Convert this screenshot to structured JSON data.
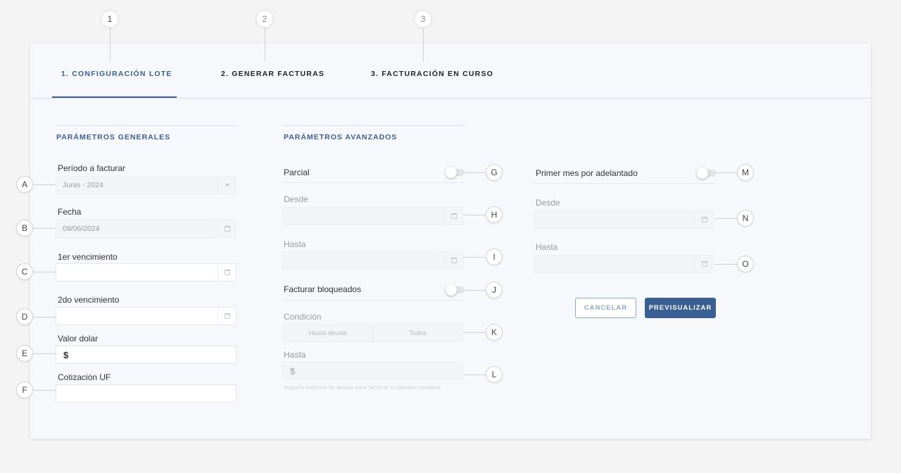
{
  "markers": {
    "step1": "1",
    "step2": "2",
    "step3": "3",
    "a": "A",
    "b": "B",
    "c": "C",
    "d": "D",
    "e": "E",
    "f": "F",
    "g": "G",
    "h": "H",
    "i": "I",
    "j": "J",
    "k": "K",
    "l": "L",
    "m": "M",
    "n": "N",
    "o": "O"
  },
  "tabs": [
    {
      "label": "1. CONFIGURACIÓN LOTE",
      "active": true
    },
    {
      "label": "2. GENERAR FACTURAS",
      "active": false
    },
    {
      "label": "3. FACTURACIÓN EN CURSO",
      "active": false
    }
  ],
  "general": {
    "title": "PARÁMETROS GENERALES",
    "periodo_label": "Período a facturar",
    "periodo_value": "Junio - 2024",
    "fecha_label": "Fecha",
    "fecha_value": "09/06/2024",
    "venc1_label": "1er vencimiento",
    "venc1_value": "",
    "venc2_label": "2do vencimiento",
    "venc2_value": "",
    "dolar_label": "Valor dolar",
    "dolar_prefix": "$",
    "uf_label": "Cotización UF",
    "uf_value": ""
  },
  "advanced": {
    "title": "PARÁMETROS AVANZADOS",
    "parcial_label": "Parcial",
    "desde_label": "Desde",
    "hasta_label": "Hasta",
    "bloqueados_label": "Facturar bloqueados",
    "condicion_label": "Condición",
    "condicion_options": [
      "Hasta deuda",
      "Todos"
    ],
    "hasta_deuda_label": "Hasta",
    "hasta_deuda_prefix": "$",
    "help_text": "Importe máximo de deuda para facturar a clientes cortados",
    "primer_mes_label": "Primer mes por adelantado",
    "desde2_label": "Desde",
    "hasta2_label": "Hasta"
  },
  "actions": {
    "cancel_label": "CANCELAR",
    "preview_label": "PREVISUALIZAR"
  },
  "colors": {
    "accent": "#3a5f93",
    "background": "#f4f4f4",
    "card": "#f7f8fb"
  },
  "icons": {
    "calendar": "calendar-icon",
    "dropdown": "chevron-down-icon"
  }
}
